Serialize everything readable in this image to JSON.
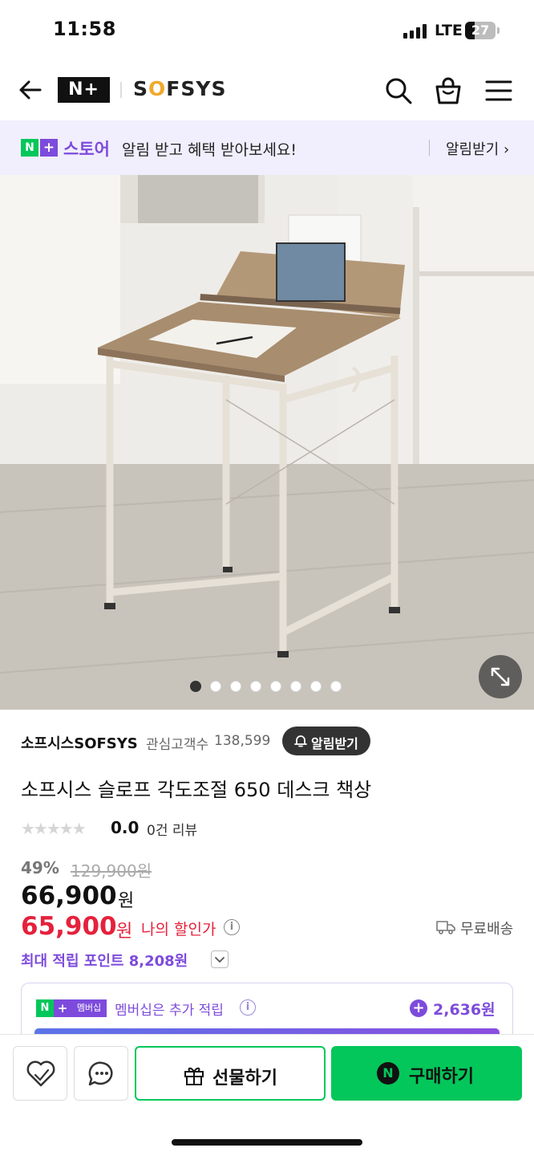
{
  "status_bar": {
    "time": "11:58",
    "network": "LTE",
    "battery": "27"
  },
  "header": {
    "logo_text": "N+",
    "brand_parts": [
      "S",
      "O",
      "FSYS"
    ],
    "icons": [
      "back-arrow-icon",
      "search-icon",
      "cart-icon",
      "menu-icon"
    ]
  },
  "notice": {
    "logo_n": "N",
    "logo_plus": "+",
    "store": "스토어",
    "message": "알림 받고 혜택 받아보세요!",
    "action": "알림받기 ›"
  },
  "gallery": {
    "count": 8,
    "active_index": 0
  },
  "product": {
    "seller": "소프시스SOFSYS",
    "followers_label": "관심고객수",
    "followers": "138,599",
    "alarm_button": "알림받기",
    "title": "소프시스 슬로프 각도조절 650 데스크 책상",
    "stars": "★★★★★",
    "rating": "0.0",
    "reviews": "0건 리뷰"
  },
  "pricing": {
    "discount": "49%",
    "original": "129,900원",
    "price": "66,900",
    "price_unit": "원",
    "my_price": "65,900",
    "my_price_unit": "원",
    "my_price_label": "나의 할인가",
    "shipping": "무료배송",
    "points": "최대 적립 포인트 8,208원"
  },
  "membership": {
    "badge_n": "N",
    "badge_plus": "+",
    "badge_label": "멤버십",
    "text": "멤버십은 추가 적립",
    "plus_sign": "+",
    "amount": "2,636원"
  },
  "bottom_bar": {
    "gift_label": "선물하기",
    "buy_icon": "N",
    "buy_label": "구매하기",
    "info_glyph": "i"
  }
}
